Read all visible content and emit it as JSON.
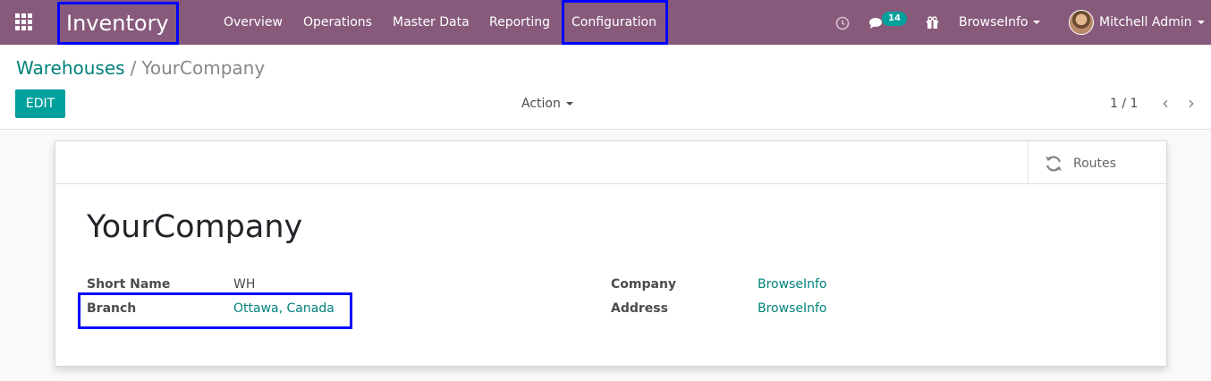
{
  "navbar": {
    "app_title": "Inventory",
    "menu": [
      {
        "label": "Overview"
      },
      {
        "label": "Operations"
      },
      {
        "label": "Master Data"
      },
      {
        "label": "Reporting"
      },
      {
        "label": "Configuration"
      }
    ],
    "messages_count": "14",
    "company_switcher": "BrowseInfo",
    "user_name": "Mitchell Admin"
  },
  "breadcrumb": {
    "parent": "Warehouses",
    "separator": "/",
    "current": "YourCompany"
  },
  "control_panel": {
    "edit_label": "EDIT",
    "action_label": "Action",
    "pager": "1 / 1"
  },
  "form": {
    "smart_button_routes": "Routes",
    "title": "YourCompany",
    "fields": {
      "short_name_label": "Short Name",
      "short_name_value": "WH",
      "branch_label": "Branch",
      "branch_value": "Ottawa, Canada",
      "company_label": "Company",
      "company_value": "BrowseInfo",
      "address_label": "Address",
      "address_value": "BrowseInfo"
    }
  },
  "colors": {
    "navbar": "#875a7b",
    "primary": "#00a09d",
    "link": "#00827c",
    "highlight_box": "#0000ff"
  },
  "icons": [
    "apps-grid-icon",
    "clock-icon",
    "chat-icon",
    "gift-icon",
    "caret-down-icon",
    "chevron-left-icon",
    "chevron-right-icon",
    "refresh-icon"
  ]
}
